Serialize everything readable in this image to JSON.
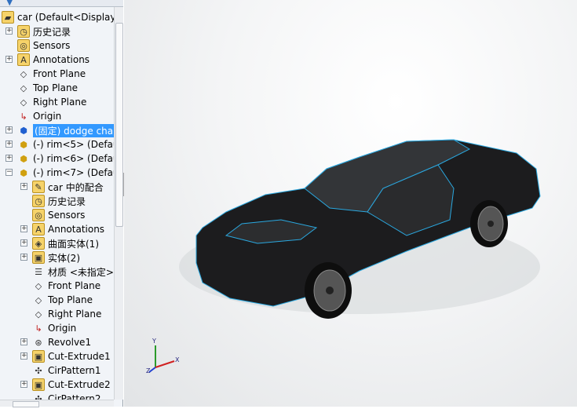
{
  "tree": {
    "items": [
      {
        "label": "car  (Default<Display",
        "icon": "assembly-icon",
        "level": 0,
        "expander": "none"
      },
      {
        "label": "历史记录",
        "icon": "history-folder-icon",
        "level": 1,
        "expander": "plus"
      },
      {
        "label": "Sensors",
        "icon": "sensors-folder-icon",
        "level": 1,
        "expander": "none"
      },
      {
        "label": "Annotations",
        "icon": "annotations-icon",
        "level": 1,
        "expander": "plus"
      },
      {
        "label": "Front Plane",
        "icon": "plane-icon",
        "level": 1,
        "expander": "none"
      },
      {
        "label": "Top Plane",
        "icon": "plane-icon",
        "level": 1,
        "expander": "none"
      },
      {
        "label": "Right Plane",
        "icon": "plane-icon",
        "level": 1,
        "expander": "none"
      },
      {
        "label": "Origin",
        "icon": "origin-icon",
        "level": 1,
        "expander": "none"
      },
      {
        "label": "(固定) dodge cha",
        "icon": "part-blue-icon",
        "level": 1,
        "expander": "plus",
        "selected": true
      },
      {
        "label": "(-) rim<5> (Defau",
        "icon": "part-yellow-icon",
        "level": 1,
        "expander": "plus"
      },
      {
        "label": "(-) rim<6> (Defau",
        "icon": "part-yellow-icon",
        "level": 1,
        "expander": "plus"
      },
      {
        "label": "(-) rim<7> (Defau",
        "icon": "part-yellow-icon",
        "level": 1,
        "expander": "minus"
      },
      {
        "label": "car 中的配合",
        "icon": "mates-folder-icon",
        "level": 2,
        "expander": "plus"
      },
      {
        "label": "历史记录",
        "icon": "history-folder-icon",
        "level": 2,
        "expander": "none"
      },
      {
        "label": "Sensors",
        "icon": "sensors-folder-icon",
        "level": 2,
        "expander": "none"
      },
      {
        "label": "Annotations",
        "icon": "annotations-icon",
        "level": 2,
        "expander": "plus"
      },
      {
        "label": "曲面实体(1)",
        "icon": "surface-bodies-icon",
        "level": 2,
        "expander": "plus"
      },
      {
        "label": "实体(2)",
        "icon": "solid-bodies-icon",
        "level": 2,
        "expander": "plus"
      },
      {
        "label": "材质 <未指定>",
        "icon": "material-icon",
        "level": 2,
        "expander": "none"
      },
      {
        "label": "Front Plane",
        "icon": "plane-icon",
        "level": 2,
        "expander": "none"
      },
      {
        "label": "Top Plane",
        "icon": "plane-icon",
        "level": 2,
        "expander": "none"
      },
      {
        "label": "Right Plane",
        "icon": "plane-icon",
        "level": 2,
        "expander": "none"
      },
      {
        "label": "Origin",
        "icon": "origin-icon",
        "level": 2,
        "expander": "none"
      },
      {
        "label": "Revolve1",
        "icon": "revolve-icon",
        "level": 2,
        "expander": "plus"
      },
      {
        "label": "Cut-Extrude1",
        "icon": "cut-extrude-icon",
        "level": 2,
        "expander": "plus"
      },
      {
        "label": "CirPattern1",
        "icon": "circular-pattern-icon",
        "level": 2,
        "expander": "none"
      },
      {
        "label": "Cut-Extrude2",
        "icon": "cut-extrude-icon",
        "level": 2,
        "expander": "plus"
      },
      {
        "label": "CirPattern2",
        "icon": "circular-pattern-icon",
        "level": 2,
        "expander": "none"
      }
    ]
  },
  "triad": {
    "x": "X",
    "y": "Y",
    "z": "Z"
  },
  "colors": {
    "selection": "#3399ff",
    "edge_highlight": "#2aa8e0",
    "car_body": "#1a1a1a"
  }
}
